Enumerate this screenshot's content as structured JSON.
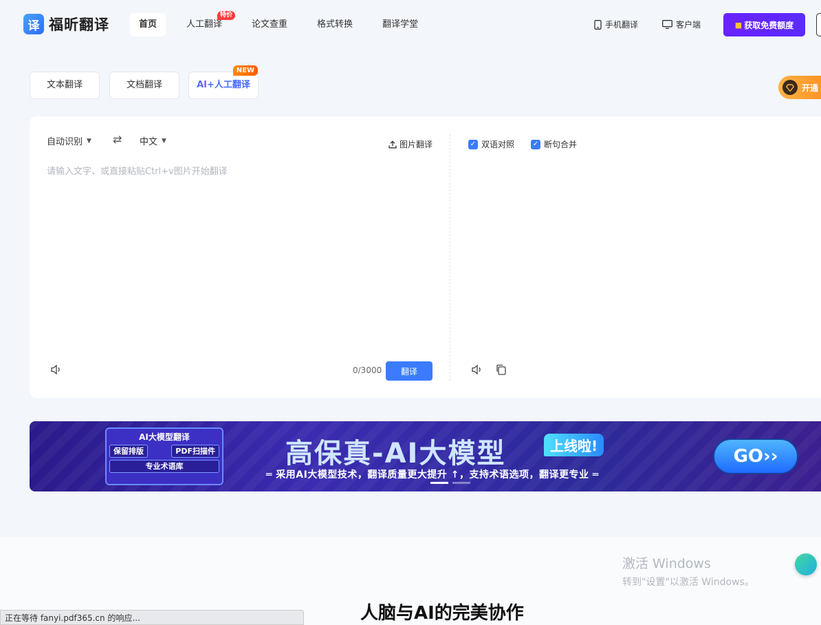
{
  "header": {
    "logo_glyph": "译",
    "logo_text": "福昕翻译",
    "nav": [
      {
        "label": "首页",
        "active": true
      },
      {
        "label": "人工翻译",
        "badge": "特价"
      },
      {
        "label": "论文查重"
      },
      {
        "label": "格式转换"
      },
      {
        "label": "翻译学堂"
      }
    ],
    "phone_label": "手机翻译",
    "client_label": "客户端",
    "cta_label": "获取免费额度"
  },
  "modes": {
    "text": "文本翻译",
    "doc": "文档翻译",
    "ai_prefix": "AI",
    "ai_suffix": "+人工翻译",
    "new_badge": "NEW",
    "vip_label": "开通"
  },
  "translator": {
    "source_lang": "自动识别",
    "target_lang": "中文",
    "image_translate": "图片翻译",
    "placeholder": "请输入文字、或直接粘贴Ctrl+v图片开始翻译",
    "counter": "0/3000",
    "translate_button": "翻译",
    "bilingual_label": "双语对照",
    "merge_label": "断句合并"
  },
  "banner": {
    "card_title": "AI大模型翻译",
    "chip_1": "保留排版",
    "chip_2": "PDF扫描件",
    "chip_3": "专业术语库",
    "headline": "高保真-AI大模型",
    "online_tag": "上线啦!",
    "subtitle": "═ 采用AI大模型技术，翻译质量更大提升 ↑，支持术语选项，翻译更专业 ═",
    "go_label": "GO››"
  },
  "section_title": "人脑与AI的完美协作",
  "watermark": {
    "line1": "激活 Windows",
    "line2": "转到\"设置\"以激活 Windows。"
  },
  "status_text": "正在等待 fanyi.pdf365.cn 的响应..."
}
